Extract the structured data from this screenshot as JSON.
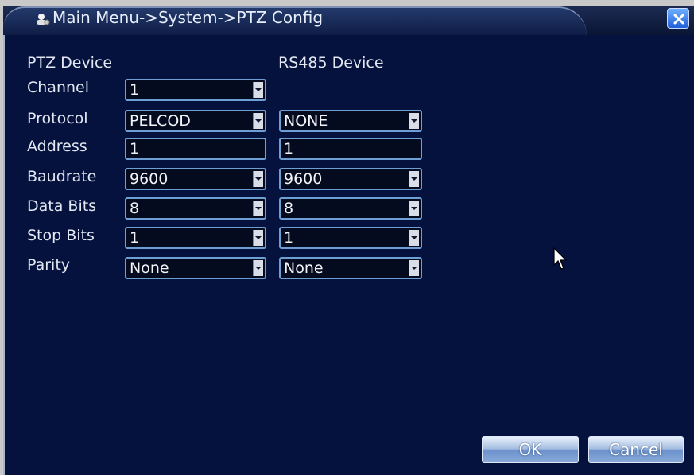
{
  "window": {
    "title": "Main Menu->System->PTZ Config",
    "icon": "settings-person-icon",
    "close_icon": "close-icon"
  },
  "sections": {
    "ptz_device": "PTZ Device",
    "rs485_device": "RS485 Device"
  },
  "rows": [
    {
      "label": "Channel",
      "ptz": "1",
      "ptz_type": "select",
      "rs485": null
    },
    {
      "label": "Protocol",
      "ptz": "PELCOD",
      "ptz_type": "select",
      "rs485": "NONE",
      "rs485_type": "select"
    },
    {
      "label": "Address",
      "ptz": "1",
      "ptz_type": "input",
      "rs485": "1",
      "rs485_type": "input"
    },
    {
      "label": "Baudrate",
      "ptz": "9600",
      "ptz_type": "select",
      "rs485": "9600",
      "rs485_type": "select"
    },
    {
      "label": "Data Bits",
      "ptz": "8",
      "ptz_type": "select",
      "rs485": "8",
      "rs485_type": "select"
    },
    {
      "label": "Stop Bits",
      "ptz": "1",
      "ptz_type": "select",
      "rs485": "1",
      "rs485_type": "select"
    },
    {
      "label": "Parity",
      "ptz": "None",
      "ptz_type": "select",
      "rs485": "None",
      "rs485_type": "select"
    }
  ],
  "buttons": {
    "ok": "OK",
    "cancel": "Cancel"
  },
  "colors": {
    "background": "#05123e",
    "field_border": "#6d9ed4",
    "text": "#e2e7f2"
  }
}
